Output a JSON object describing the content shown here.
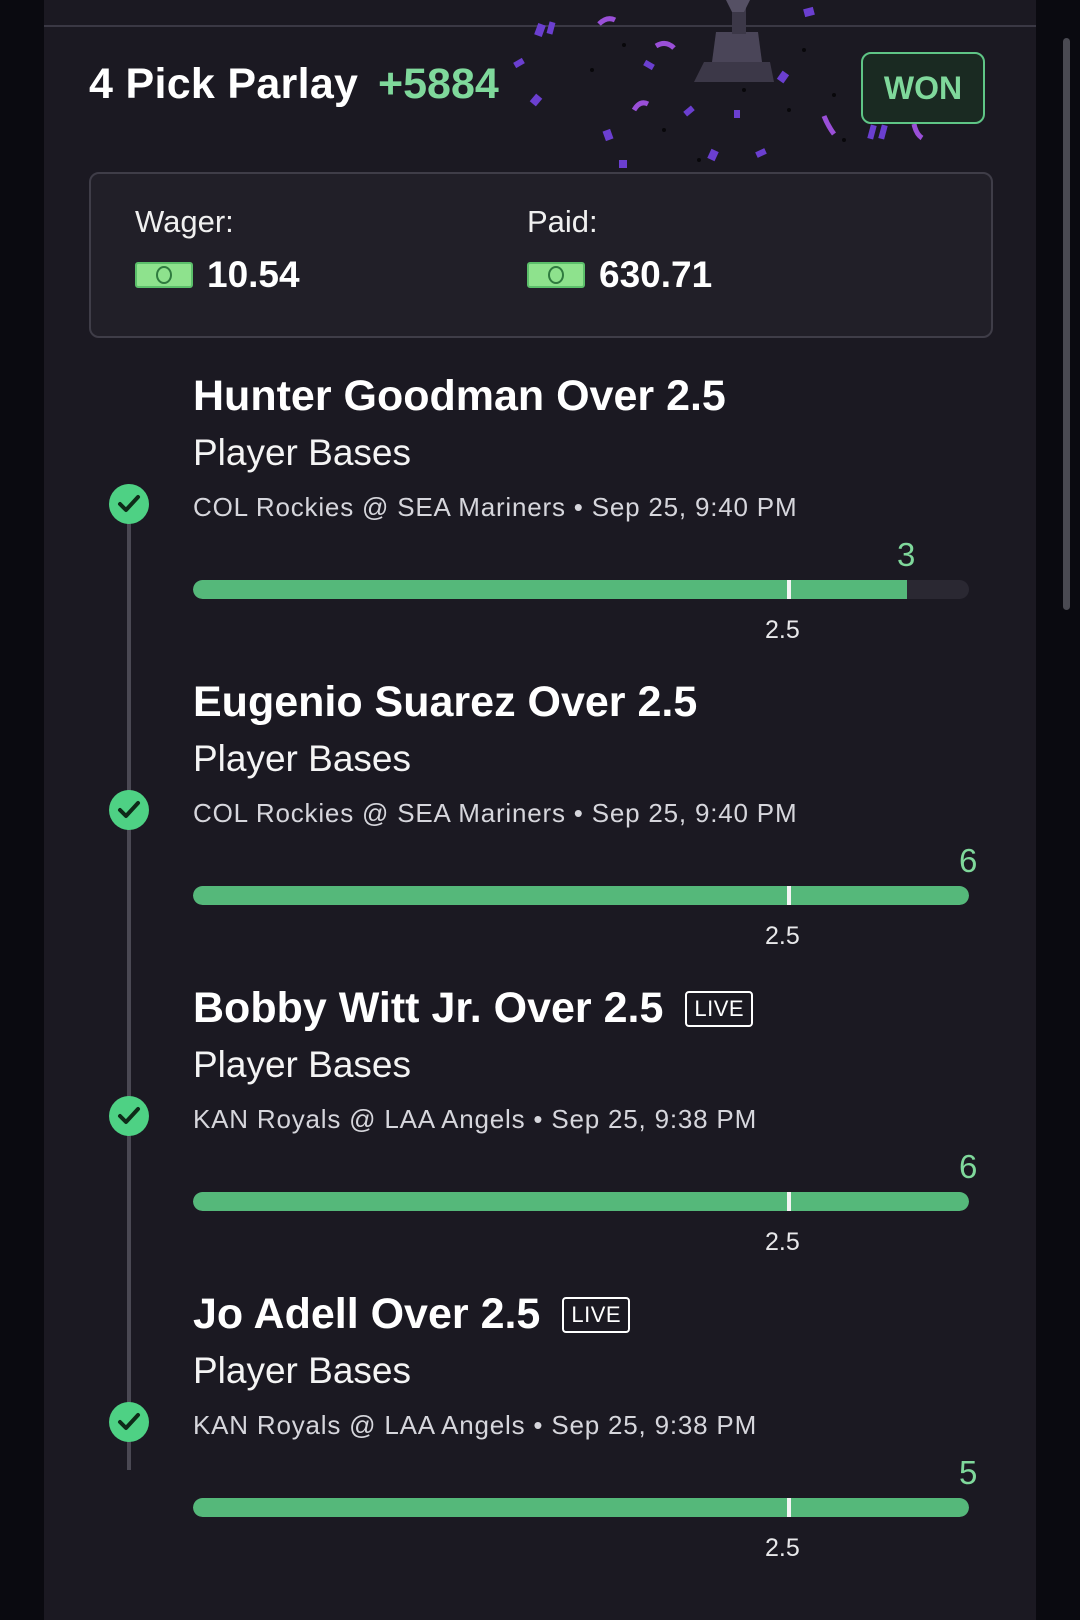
{
  "header": {
    "title": "4 Pick Parlay",
    "odds": "+5884",
    "status": "WON"
  },
  "summary": {
    "wager_label": "Wager:",
    "wager_value": "10.54",
    "paid_label": "Paid:",
    "paid_value": "630.71",
    "currency_icon": "cash-icon"
  },
  "colors": {
    "accent_green": "#7fd89b",
    "bar_green": "#55b87a",
    "check_green": "#4ed184",
    "card_bg": "#1b1922"
  },
  "picks": [
    {
      "title": "Hunter Goodman Over 2.5",
      "live": "",
      "market": "Player Bases",
      "game": "COL Rockies @ SEA Mariners • Sep 25, 9:40 PM",
      "result": "3",
      "line": "2.5",
      "progress_fraction": 0.92
    },
    {
      "title": "Eugenio Suarez Over 2.5",
      "live": "",
      "market": "Player Bases",
      "game": "COL Rockies @ SEA Mariners • Sep 25, 9:40 PM",
      "result": "6",
      "line": "2.5",
      "progress_fraction": 1.0
    },
    {
      "title": "Bobby Witt Jr. Over 2.5",
      "live": "LIVE",
      "market": "Player Bases",
      "game": "KAN Royals @ LAA Angels • Sep 25, 9:38 PM",
      "result": "6",
      "line": "2.5",
      "progress_fraction": 1.0
    },
    {
      "title": "Jo Adell Over 2.5",
      "live": "LIVE",
      "market": "Player Bases",
      "game": "KAN Royals @ LAA Angels • Sep 25, 9:38 PM",
      "result": "5",
      "line": "2.5",
      "progress_fraction": 1.0
    }
  ]
}
